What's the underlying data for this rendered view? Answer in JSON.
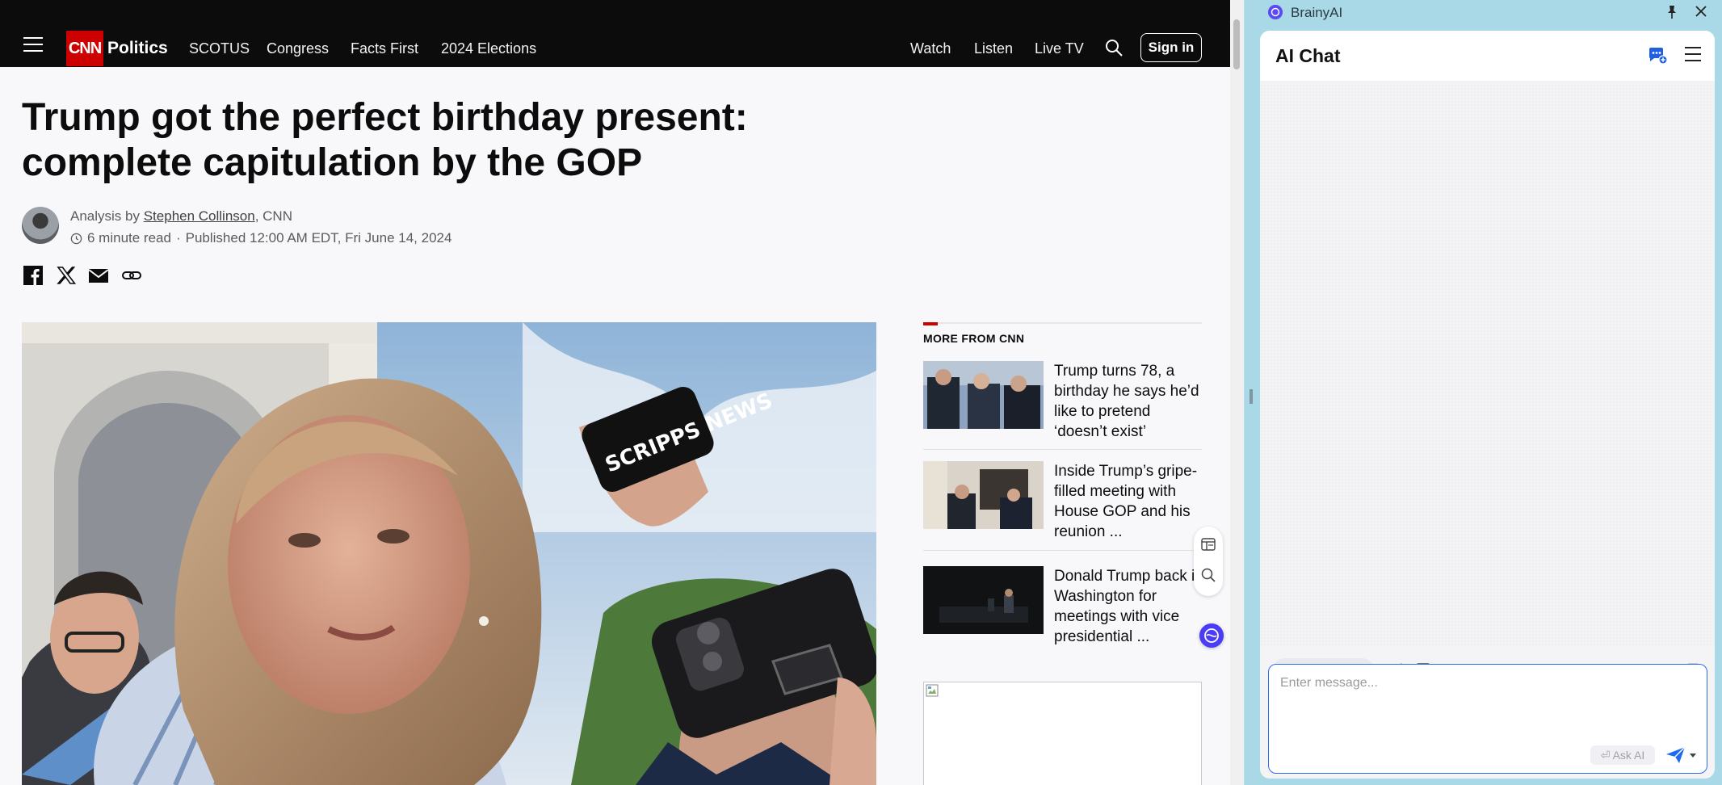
{
  "nav": {
    "logo": "CNN",
    "section": "Politics",
    "links": [
      "SCOTUS",
      "Congress",
      "Facts First",
      "2024 Elections"
    ],
    "right_links": [
      "Watch",
      "Listen",
      "Live TV"
    ],
    "sign_in": "Sign in"
  },
  "article": {
    "headline": "Trump got the perfect birthday present: complete capitulation by the GOP",
    "byline_prefix": "Analysis by",
    "author": "Stephen Collinson",
    "outlet": ", CNN",
    "read_time": "6 minute read",
    "dot": "·",
    "published": "Published 12:00 AM EDT, Fri June 14, 2024",
    "hero_phone_text": "SCRIPPS NEWS"
  },
  "more_from": {
    "title": "MORE FROM CNN",
    "stories": [
      {
        "title": "Trump turns 78, a birthday he says he’d like to pretend ‘doesn’t exist’"
      },
      {
        "title": "Inside Trump’s gripe-filled meeting with House GOP and his reunion ..."
      },
      {
        "title": "Donald Trump back in Washington for meetings with vice presidential ..."
      }
    ]
  },
  "panel": {
    "app_name": "BrainyAI",
    "chat_title": "AI Chat",
    "input_placeholder": "Enter message...",
    "ask_ai": "⏎ Ask AI"
  },
  "colors": {
    "cnn_red": "#cc0000",
    "nav_bg": "#0c0c0c",
    "panel_bg": "#a9d8e6",
    "input_border": "#2b6cf2",
    "send_blue": "#1e6bf0"
  }
}
